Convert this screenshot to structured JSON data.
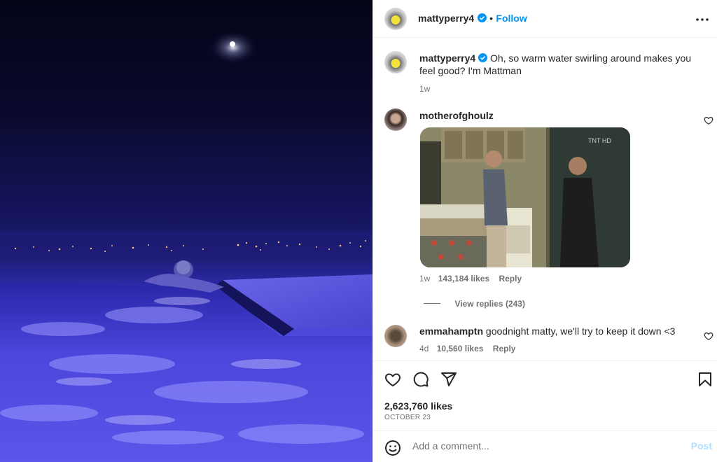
{
  "header": {
    "username": "mattyperry4",
    "separator": "•",
    "follow_label": "Follow",
    "more_icon": "more-horizontal-icon"
  },
  "caption": {
    "username": "mattyperry4",
    "text": "Oh, so warm water swirling around makes you feel good? I'm Mattman",
    "time": "1w"
  },
  "comments": [
    {
      "username": "motherofghoulz",
      "text": "",
      "time": "1w",
      "likes": "143,184 likes",
      "reply_label": "Reply",
      "view_replies": "View replies (243)",
      "gif_watermark": "TNT HD"
    },
    {
      "username": "emmahamptn",
      "text": "goodnight matty, we'll try to keep it down <3",
      "time": "4d",
      "likes": "10,560 likes",
      "reply_label": "Reply"
    }
  ],
  "actions": {
    "likes": "2,623,760 likes",
    "date": "OCTOBER 23"
  },
  "compose": {
    "placeholder": "Add a comment...",
    "post_label": "Post"
  },
  "colors": {
    "accent": "#0095f6",
    "muted": "#737373",
    "post_disabled": "#b2dffc",
    "verified": "#0095f6"
  }
}
